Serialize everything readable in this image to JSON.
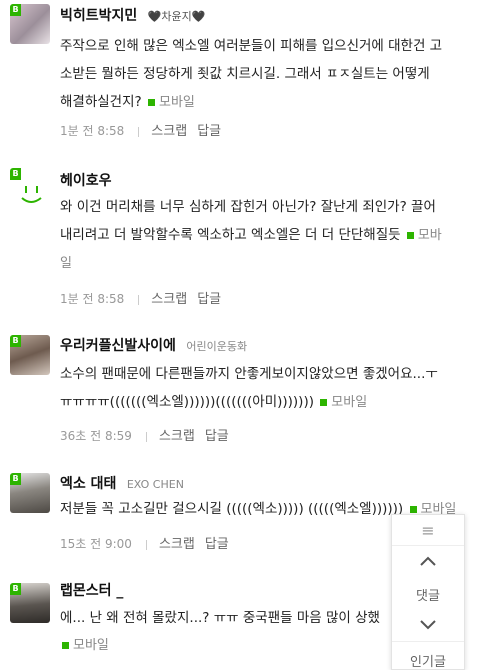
{
  "colors": {
    "accent": "#2db400",
    "meta": "#999999",
    "name": "#111111"
  },
  "comments": [
    {
      "name": "빅히트박지민",
      "tag": "🖤차윤지🖤",
      "lines": [
        "주작으로 인해 많은 엑소엘 여러분들이 피해를 입으신거에 대한건 고",
        "소받든 뭘하든 정당하게 죗값 치르시길. 그래서 ㅍㅈ실트는 어떻게",
        "해결하실건지? "
      ],
      "mobile": "모바일",
      "time": "1분 전 8:58",
      "scrap": "스크랩",
      "reply": "답글"
    },
    {
      "name": "헤이호우",
      "tag": "",
      "lines": [
        "와 이건 머리채를 너무 심하게 잡힌거 아닌가? 잘난게 죄인가? 끌어",
        "내리려고 더 발악할수록 엑소하고 엑소엘은 더 더 단단해질듯 "
      ],
      "mobile": "모바",
      "mobile_wrap": "일",
      "time": "1분 전 8:58",
      "scrap": "스크랩",
      "reply": "답글"
    },
    {
      "name": "우리커플신발사이에",
      "tag": "어린이운동화",
      "lines": [
        "소수의 팬때문에 다른팬들까지 안좋게보이지않았으면 좋겠어요...ㅜ",
        "ㅠㅠㅠㅠ(((((((엑소엘))))))(((((((아미))))))) "
      ],
      "mobile": "모바일",
      "time": "36초 전 8:59",
      "scrap": "스크랩",
      "reply": "답글"
    },
    {
      "name": "엑소 대태",
      "tag": "EXO CHEN",
      "lines": [
        "저분들 꼭 고소길만 걸으시길 (((((엑소))))) (((((엑소엘)))))) "
      ],
      "mobile": "모바일",
      "time": "15초 전 9:00",
      "scrap": "스크랩",
      "reply": "답글"
    },
    {
      "name": "랩몬스터 _",
      "tag": "",
      "lines": [
        "에... 난 왜 전혀 몰랐지...? ㅠㅠ 중국팬들 마음 많이 상했"
      ],
      "mobile": "모바일"
    }
  ],
  "floating_menu": {
    "menu_icon": "≡",
    "up_icon": "chevron-up",
    "reply_label": "댓글",
    "down_icon": "chevron-down",
    "popular_label": "인기글"
  },
  "heyhou_avatar_text": "·|·"
}
